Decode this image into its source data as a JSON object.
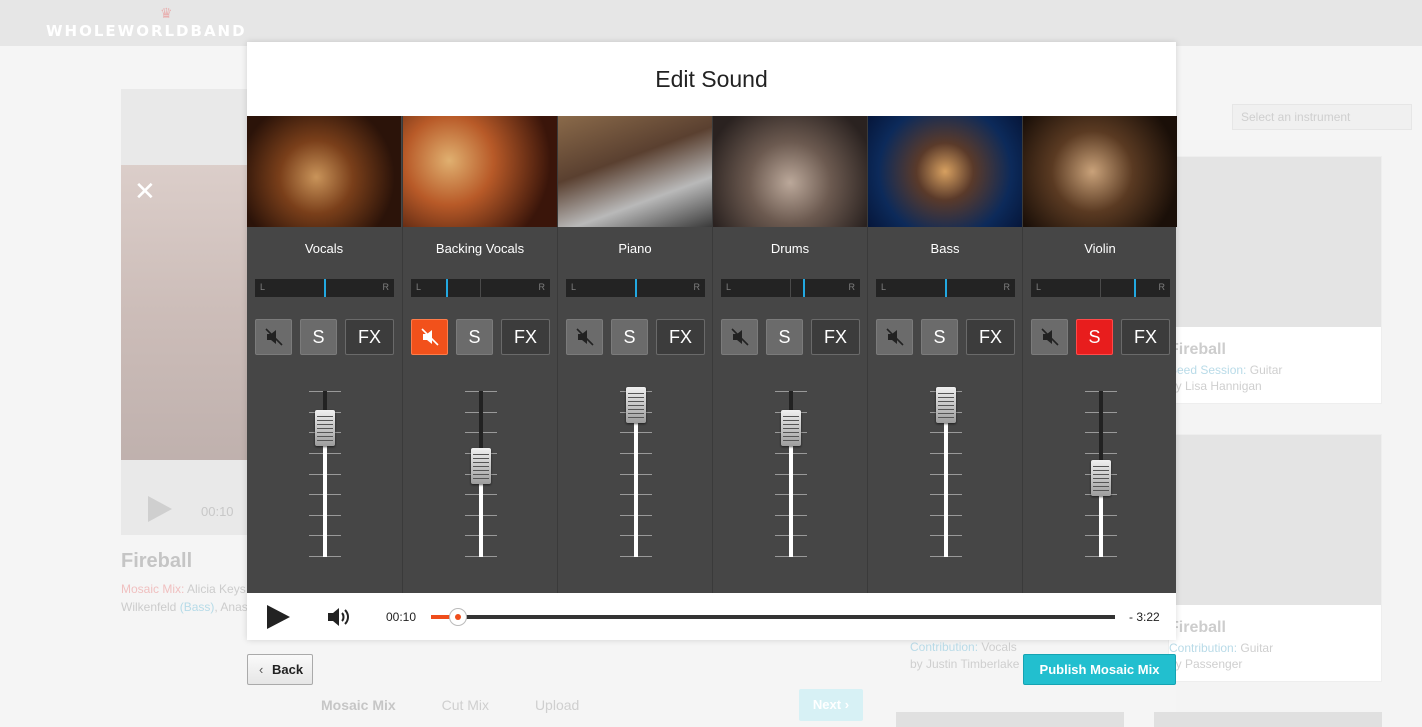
{
  "background": {
    "logo": "WHOLEWORLDBAND",
    "time": "00:10",
    "title": "Fireball",
    "mix_label": "Mosaic Mix:",
    "mix_artist": "Alicia Keys",
    "line2_name": "Wilkenfeld",
    "line2_role": "(Bass)",
    "line2_more": "Anas",
    "steps": [
      "Mosaic Mix",
      "Cut Mix",
      "Upload"
    ],
    "next": "Next",
    "select_placeholder": "Select an instrument",
    "cards": [
      {
        "title": "Fireball",
        "label": "Seed Session:",
        "value": "Guitar",
        "by": "by Lisa Hannigan"
      },
      {
        "title": "Fireball",
        "label": "Contribution:",
        "value": "Guitar",
        "by": "by Passenger"
      }
    ],
    "mid_card": {
      "label": "Contribution:",
      "value": "Vocals",
      "by": "by Justin Timberlake"
    }
  },
  "modal": {
    "title": "Edit Sound",
    "channels": [
      {
        "name": "Vocals",
        "pan": 0.5,
        "mute": false,
        "solo": false,
        "level": 0.86,
        "photo": "vocals-photo"
      },
      {
        "name": "Backing Vocals",
        "pan": 0.26,
        "mute": true,
        "solo": false,
        "level": 0.63,
        "photo": "backing-vocals-photo"
      },
      {
        "name": "Piano",
        "pan": 0.5,
        "mute": false,
        "solo": false,
        "level": 1.0,
        "photo": "piano-photo"
      },
      {
        "name": "Drums",
        "pan": 0.6,
        "mute": false,
        "solo": false,
        "level": 0.86,
        "photo": "drums-photo"
      },
      {
        "name": "Bass",
        "pan": 0.5,
        "mute": false,
        "solo": false,
        "level": 1.0,
        "photo": "bass-photo"
      },
      {
        "name": "Violin",
        "pan": 0.75,
        "mute": false,
        "solo": true,
        "level": 0.56,
        "photo": "violin-photo"
      }
    ],
    "solo_label": "S",
    "fx_label": "FX",
    "player": {
      "current": "00:10",
      "remaining": "- 3:22",
      "progress": 0.04
    },
    "back": "Back",
    "publish": "Publish Mosaic Mix"
  },
  "colors": {
    "accent": "#22bfcf",
    "mute_on": "#f2511b",
    "solo_on": "#e81d1d",
    "pan_indicator": "#22a8e0"
  }
}
